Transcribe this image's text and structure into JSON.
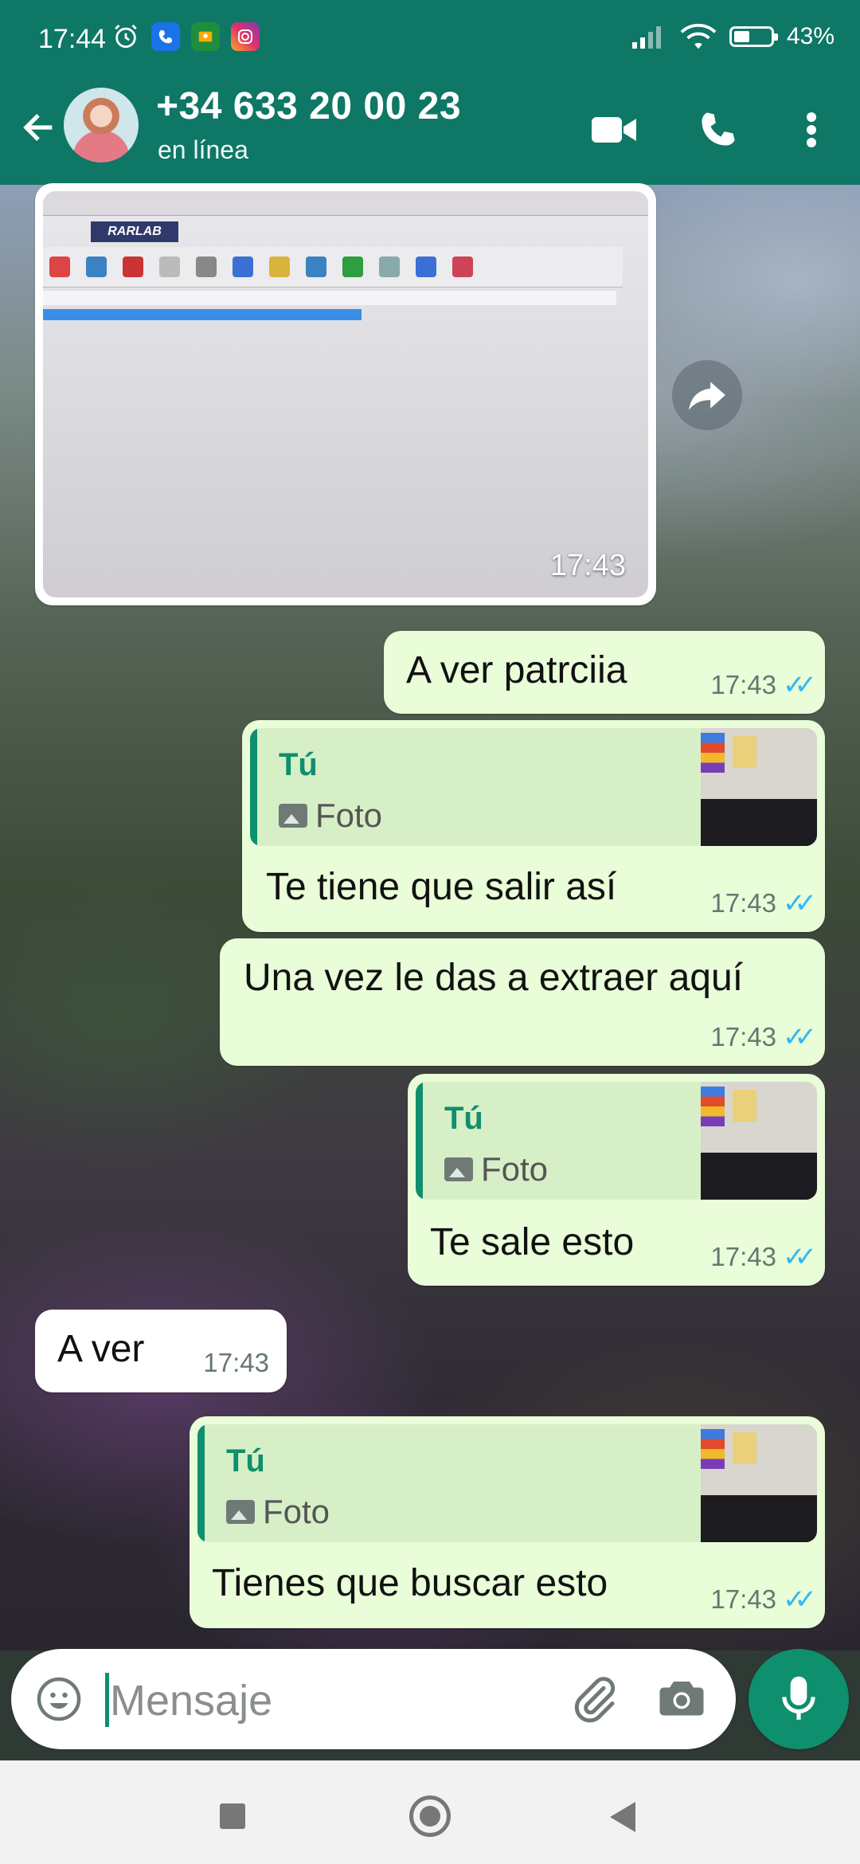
{
  "status_bar": {
    "time": "17:44",
    "battery": "43%",
    "battery_level": 0.43
  },
  "header": {
    "contact_name": "+34 633 20 00 23",
    "status": "en línea"
  },
  "messages": {
    "photo": {
      "time": "17:43"
    },
    "m1": {
      "text": "A ver patrciia",
      "time": "17:43"
    },
    "m2": {
      "quote_author": "Tú",
      "quote_type": "Foto",
      "text": "Te tiene que salir así",
      "time": "17:43"
    },
    "m3": {
      "text": "Una vez le das a extraer aquí",
      "time": "17:43"
    },
    "m4": {
      "quote_author": "Tú",
      "quote_type": "Foto",
      "text": "Te sale esto",
      "time": "17:43"
    },
    "m5": {
      "text": "A ver",
      "time": "17:43"
    },
    "m6": {
      "quote_author": "Tú",
      "quote_type": "Foto",
      "text": "Tienes que buscar esto",
      "time": "17:43"
    }
  },
  "input": {
    "placeholder": "Mensaje"
  },
  "colors": {
    "header": "#0e7766",
    "outgoing_bubble": "#e8fdd8",
    "incoming_bubble": "#ffffff",
    "read_ticks": "#34b7f1",
    "accent": "#0e8f6e"
  },
  "icons": [
    "back-arrow-icon",
    "video-call-icon",
    "phone-icon",
    "more-vert-icon",
    "share-icon",
    "emoji-icon",
    "attach-icon",
    "camera-icon",
    "mic-icon",
    "alarm-icon",
    "wifi-icon",
    "signal-icon"
  ]
}
